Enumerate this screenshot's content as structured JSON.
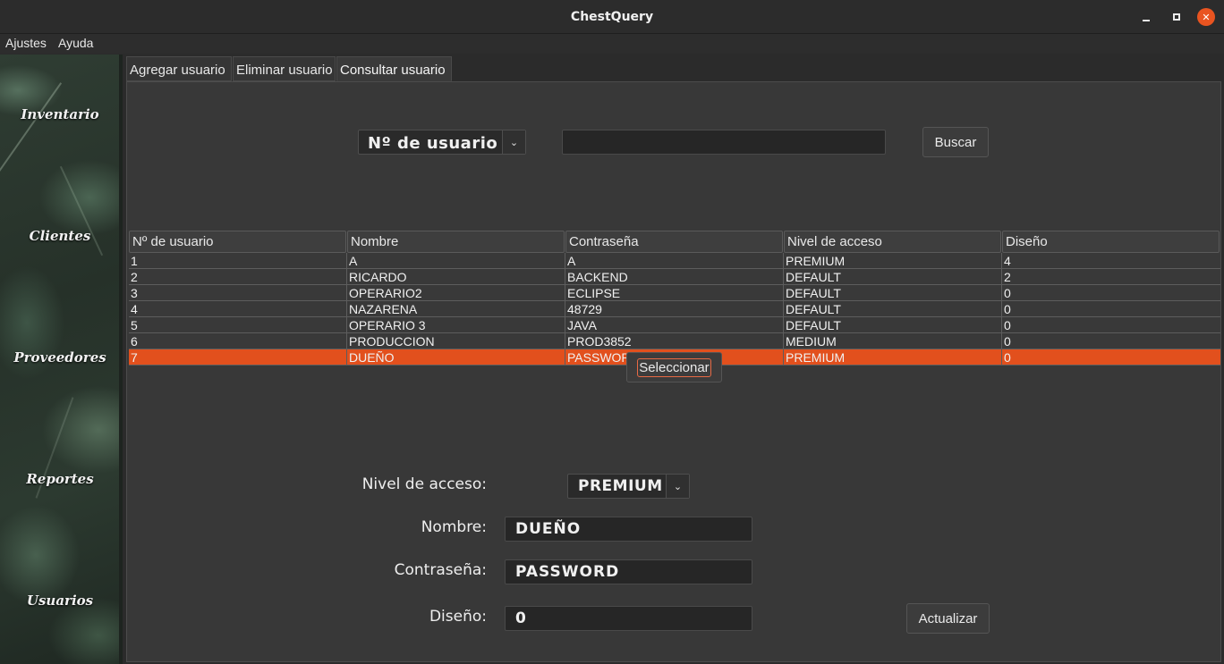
{
  "window": {
    "title": "ChestQuery"
  },
  "menu": {
    "items": [
      "Ajustes",
      "Ayuda"
    ]
  },
  "sidebar": {
    "items": [
      "Inventario",
      "Clientes",
      "Proveedores",
      "Reportes",
      "Usuarios"
    ]
  },
  "tabs": [
    "Agregar usuario",
    "Eliminar usuario",
    "Consultar usuario"
  ],
  "active_tab": 2,
  "search": {
    "field_selected": "Nº de usuario",
    "query_value": "",
    "button_label": "Buscar"
  },
  "table": {
    "columns": [
      "Nº de usuario",
      "Nombre",
      "Contraseña",
      "Nivel de acceso",
      "Diseño"
    ],
    "rows": [
      [
        "1",
        "A",
        "A",
        "PREMIUM",
        "4"
      ],
      [
        "2",
        "RICARDO",
        "BACKEND",
        "DEFAULT",
        "2"
      ],
      [
        "3",
        "OPERARIO2",
        "ECLIPSE",
        "DEFAULT",
        "0"
      ],
      [
        "4",
        "NAZARENA",
        "48729",
        "DEFAULT",
        "0"
      ],
      [
        "5",
        "OPERARIO 3",
        "JAVA",
        "DEFAULT",
        "0"
      ],
      [
        "6",
        "PRODUCCION",
        "PROD3852",
        "MEDIUM",
        "0"
      ],
      [
        "7",
        "DUEÑO",
        "PASSWORD",
        "PREMIUM",
        "0"
      ]
    ],
    "selected_row": 6
  },
  "select_button": "Seleccionar",
  "form": {
    "nivel_label": "Nivel de acceso:",
    "nivel_value": "PREMIUM",
    "nombre_label": "Nombre:",
    "nombre_value": "DUEÑO",
    "password_label": "Contraseña:",
    "password_value": "PASSWORD",
    "diseno_label": "Diseño:",
    "diseno_value": "0",
    "update_button": "Actualizar"
  },
  "colors": {
    "accent": "#e2501d",
    "close_button": "#e95420"
  },
  "icons": {
    "dropdown": "chevron-down-icon",
    "minimize": "minimize-icon",
    "maximize": "maximize-icon",
    "close": "close-icon"
  }
}
